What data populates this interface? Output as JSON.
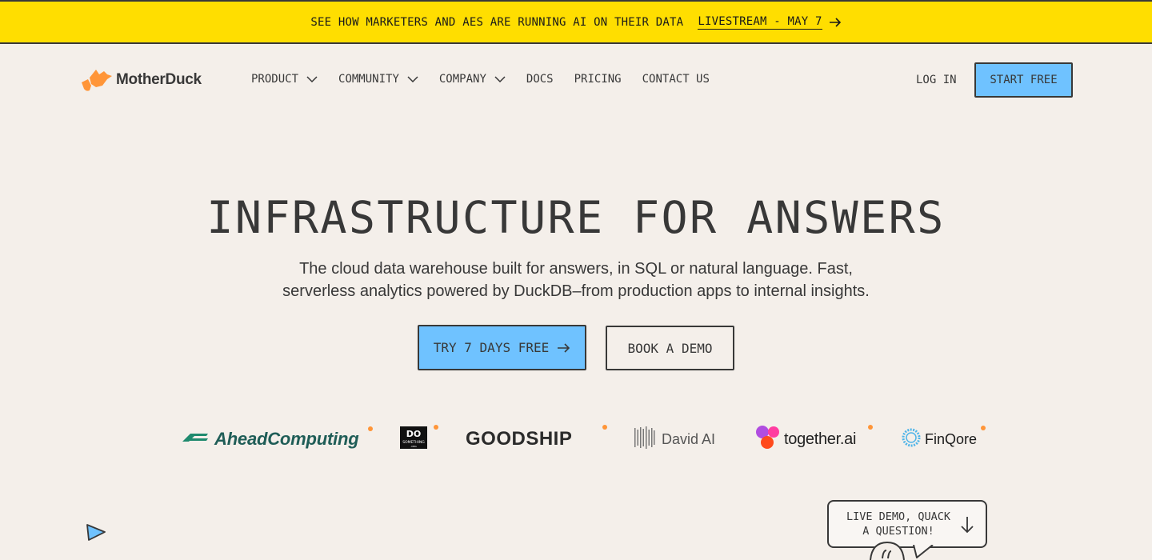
{
  "banner": {
    "text": "SEE HOW MARKETERS AND AES ARE RUNNING AI ON THEIR DATA",
    "link_label": "LIVESTREAM - MAY 7",
    "link_icon": "arrow-right-icon"
  },
  "header": {
    "brand": "MotherDuck",
    "nav": [
      {
        "label": "PRODUCT",
        "has_dropdown": true
      },
      {
        "label": "COMMUNITY",
        "has_dropdown": true
      },
      {
        "label": "COMPANY",
        "has_dropdown": true
      },
      {
        "label": "DOCS",
        "has_dropdown": false
      },
      {
        "label": "PRICING",
        "has_dropdown": false
      },
      {
        "label": "CONTACT US",
        "has_dropdown": false
      }
    ],
    "login_label": "LOG IN",
    "start_free_label": "START FREE"
  },
  "hero": {
    "title": "INFRASTRUCTURE FOR ANSWERS",
    "subtitle_line1": "The cloud data warehouse built for answers, in SQL or natural language. Fast,",
    "subtitle_line2": "serverless analytics powered by DuckDB–from production apps to internal insights.",
    "cta_primary": "TRY 7 DAYS FREE",
    "cta_secondary": "BOOK A DEMO"
  },
  "customers": [
    {
      "name": "AheadComputing"
    },
    {
      "name": "DO SOMETHING"
    },
    {
      "name": "GOODSHIP"
    },
    {
      "name": "David AI"
    },
    {
      "name": "together.ai"
    },
    {
      "name": "FinQore"
    }
  ],
  "demo_bubble": {
    "line1": "LIVE DEMO, QUACK",
    "line2": "A QUESTION!"
  },
  "colors": {
    "background": "#F4EFEA",
    "banner": "#FFDE00",
    "accent_blue": "#6FC2FF",
    "ink": "#383838",
    "brand_orange": "#FF9538"
  }
}
